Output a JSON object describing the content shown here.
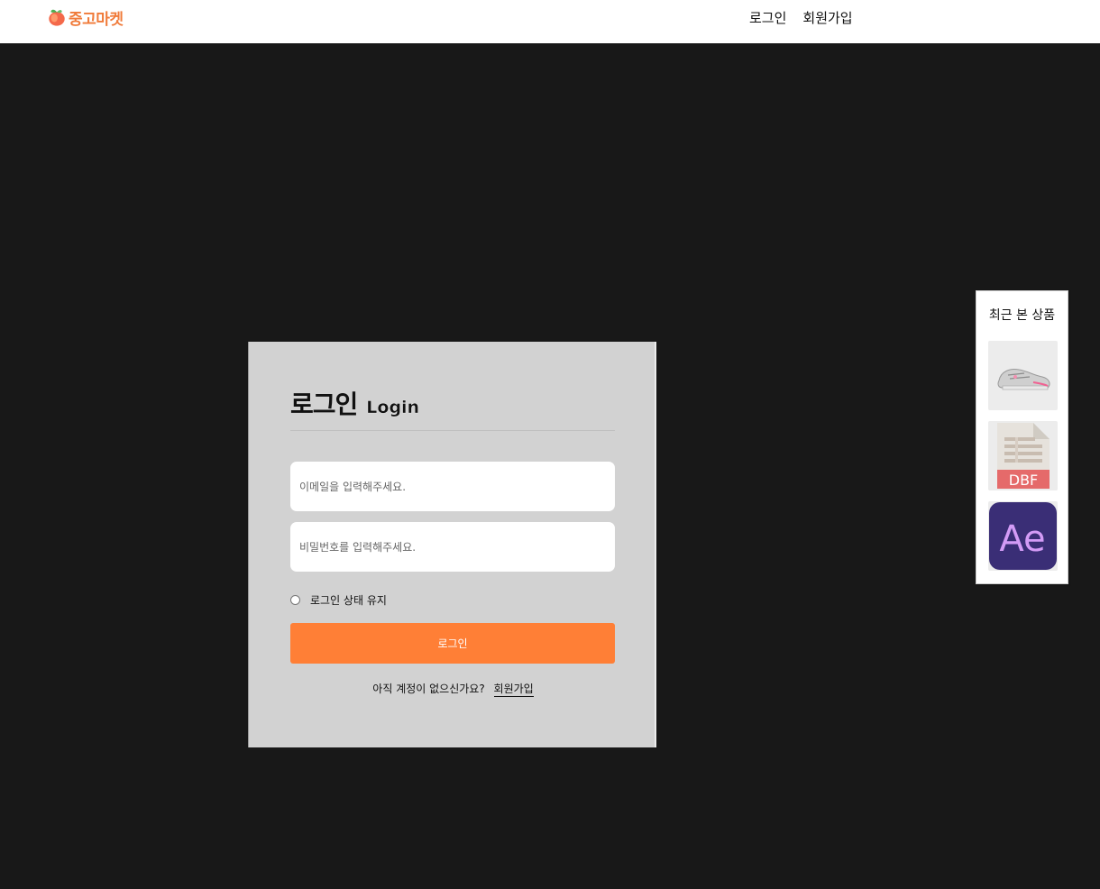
{
  "header": {
    "logo_text": "중고마켓",
    "nav": {
      "login": "로그인",
      "signup": "회원가입"
    }
  },
  "login": {
    "title_ko": "로그인",
    "title_en": "Login",
    "email_placeholder": "이메일을 입력해주세요.",
    "password_placeholder": "비밀번호를 입력해주세요.",
    "remember_label": "로그인 상태 유지",
    "submit_label": "로그인",
    "no_account_text": "아직 계정이 없으신가요?",
    "signup_link": "회원가입"
  },
  "recent": {
    "title": "최근 본 상품",
    "items": [
      {
        "icon": "sneaker-image"
      },
      {
        "icon": "dbf-file-icon",
        "label": "DBF"
      },
      {
        "icon": "after-effects-icon",
        "label": "Ae"
      }
    ]
  },
  "colors": {
    "accent": "#ff7f36",
    "logo": "#f07b3a",
    "background": "#181818",
    "card": "#d2d2d2"
  }
}
